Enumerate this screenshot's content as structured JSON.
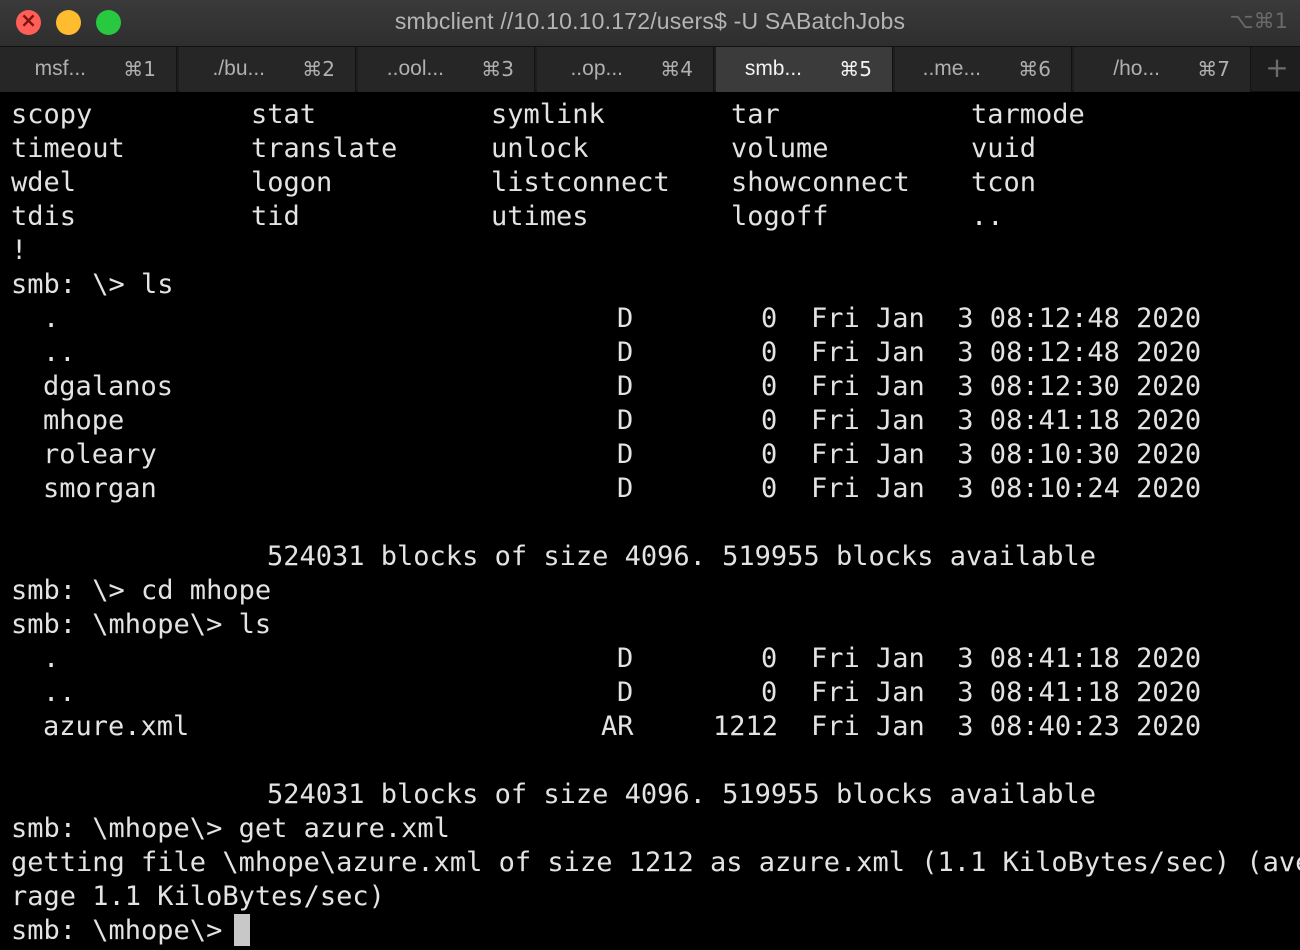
{
  "window": {
    "title": "smbclient //10.10.10.172/users$ -U SABatchJobs",
    "shortcut": "⌥⌘1"
  },
  "tabs": [
    {
      "label": "msf...",
      "key": "⌘1"
    },
    {
      "label": "./bu...",
      "key": "⌘2"
    },
    {
      "label": "..ool...",
      "key": "⌘3"
    },
    {
      "label": "..op...",
      "key": "⌘4"
    },
    {
      "label": "smb...",
      "key": "⌘5",
      "active": true
    },
    {
      "label": "..me...",
      "key": "⌘6"
    },
    {
      "label": "/ho...",
      "key": "⌘7"
    }
  ],
  "new_tab_label": "+",
  "terminal": {
    "commands_grid": [
      [
        "scopy",
        "stat",
        "symlink",
        "tar",
        "tarmode"
      ],
      [
        "timeout",
        "translate",
        "unlock",
        "volume",
        "vuid"
      ],
      [
        "wdel",
        "logon",
        "listconnect",
        "showconnect",
        "tcon"
      ],
      [
        "tdis",
        "tid",
        "utimes",
        "logoff",
        ".."
      ],
      [
        "!",
        "",
        "",
        "",
        ""
      ]
    ],
    "prompt_ls_1": "smb: \\> ls",
    "listing_1": [
      {
        "name": ".",
        "attr": "D",
        "size": "0",
        "date": "Fri Jan  3 08:12:48 2020"
      },
      {
        "name": "..",
        "attr": "D",
        "size": "0",
        "date": "Fri Jan  3 08:12:48 2020"
      },
      {
        "name": "dgalanos",
        "attr": "D",
        "size": "0",
        "date": "Fri Jan  3 08:12:30 2020"
      },
      {
        "name": "mhope",
        "attr": "D",
        "size": "0",
        "date": "Fri Jan  3 08:41:18 2020"
      },
      {
        "name": "roleary",
        "attr": "D",
        "size": "0",
        "date": "Fri Jan  3 08:10:30 2020"
      },
      {
        "name": "smorgan",
        "attr": "D",
        "size": "0",
        "date": "Fri Jan  3 08:10:24 2020"
      }
    ],
    "blocks_1": "524031 blocks of size 4096. 519955 blocks available",
    "prompt_cd": "smb: \\> cd mhope",
    "prompt_ls_2": "smb: \\mhope\\> ls",
    "listing_2": [
      {
        "name": ".",
        "attr": "D",
        "size": "0",
        "date": "Fri Jan  3 08:41:18 2020"
      },
      {
        "name": "..",
        "attr": "D",
        "size": "0",
        "date": "Fri Jan  3 08:41:18 2020"
      },
      {
        "name": "azure.xml",
        "attr": "AR",
        "size": "1212",
        "date": "Fri Jan  3 08:40:23 2020"
      }
    ],
    "blocks_2": "524031 blocks of size 4096. 519955 blocks available",
    "prompt_get": "smb: \\mhope\\> get azure.xml",
    "getting_line_1": "getting file \\mhope\\azure.xml of size 1212 as azure.xml (1.1 KiloBytes/sec) (ave",
    "getting_line_2": "rage 1.1 KiloBytes/sec)",
    "prompt_final": "smb: \\mhope\\> "
  }
}
